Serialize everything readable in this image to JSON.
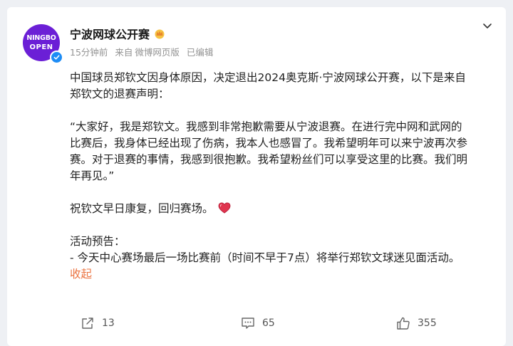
{
  "user": {
    "avatar_line1": "NINGBO",
    "avatar_line2": "OPEN",
    "name": "宁波网球公开赛"
  },
  "meta": {
    "time": "15分钟前",
    "source_prefix": "来自",
    "source": "微博网页版",
    "edited": "已编辑"
  },
  "post": {
    "lines": [
      "中国球员郑钦文因身体原因，决定退出2024奥克斯·宁波网球公开赛，以下是来自",
      "郑钦文的退赛声明：",
      "“大家好，我是郑钦文。我感到非常抱歉需要从宁波退赛。在进行完中网和武网的",
      "比赛后，我身体已经出现了伤病，我本人也感冒了。我希望明年可以来宁波再次参",
      "赛。对于退赛的事情，我感到很抱歉。我希望粉丝们可以享受这里的比赛。我们明",
      "年再见。”",
      "祝钦文早日康复，回归赛场。",
      "活动预告：",
      "- 今天中心赛场最后一场比赛前（时间不早于7点）将举行郑钦文球迷见面活动。"
    ],
    "collapse": "收起"
  },
  "actions": {
    "share_count": "13",
    "comment_count": "65",
    "like_count": "355"
  },
  "colors": {
    "avatar": "#6b1fd6",
    "verified": "#1d8cf5",
    "collapse_link": "#eb7340",
    "heart": "#e0354f"
  },
  "icons": [
    "verified-badge-icon",
    "crown-icon",
    "chevron-down-icon",
    "heart-emoji-icon",
    "share-icon",
    "comment-icon",
    "like-icon"
  ]
}
